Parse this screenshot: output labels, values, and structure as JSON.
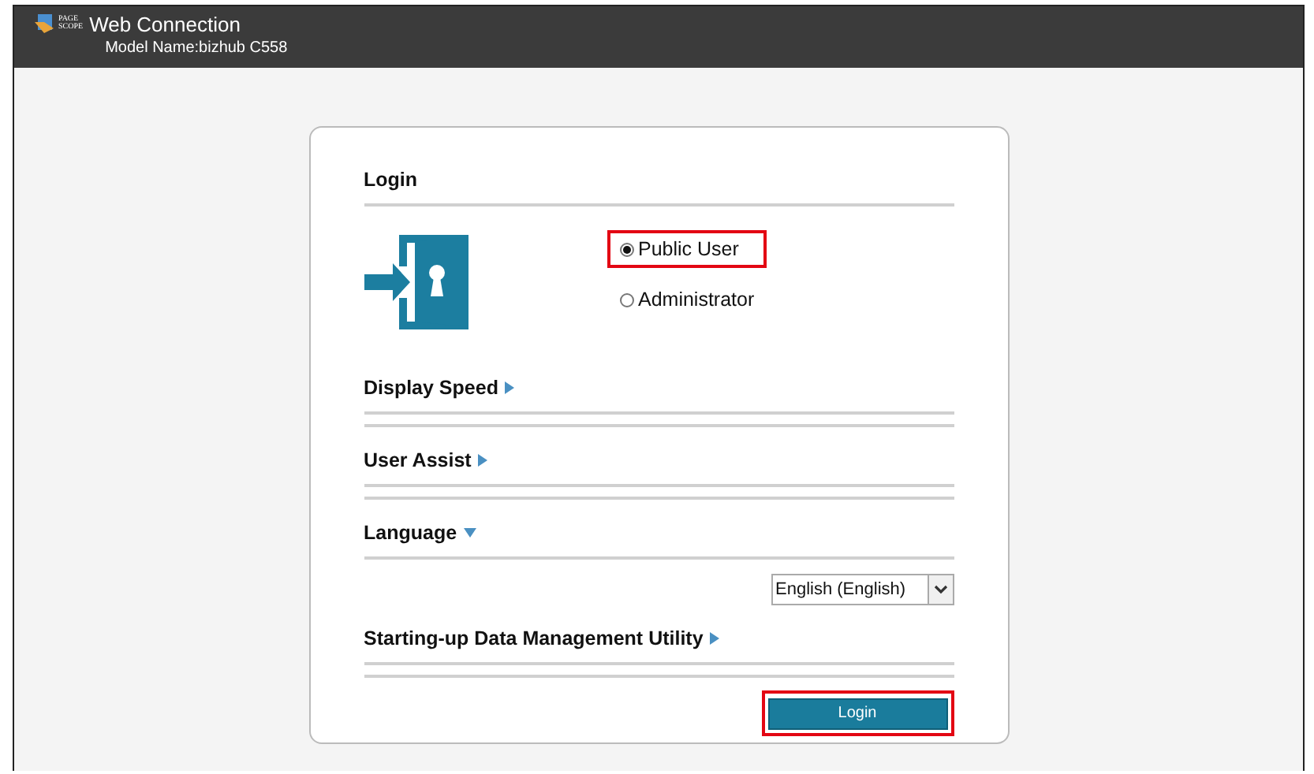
{
  "header": {
    "logo_text": [
      "PAGE",
      "SCOPE"
    ],
    "title": "Web Connection",
    "model": "Model Name:bizhub C558"
  },
  "login": {
    "heading": "Login",
    "roles": [
      {
        "label": "Public User",
        "selected": true,
        "highlighted": true
      },
      {
        "label": "Administrator",
        "selected": false,
        "highlighted": false
      }
    ]
  },
  "sections": [
    {
      "title": "Display Speed",
      "expanded": false
    },
    {
      "title": "User Assist",
      "expanded": false
    },
    {
      "title": "Language",
      "expanded": true,
      "select": {
        "value": "English (English)"
      }
    },
    {
      "title": "Starting-up Data Management Utility",
      "expanded": false
    }
  ],
  "login_button": {
    "label": "Login",
    "highlighted": true
  }
}
